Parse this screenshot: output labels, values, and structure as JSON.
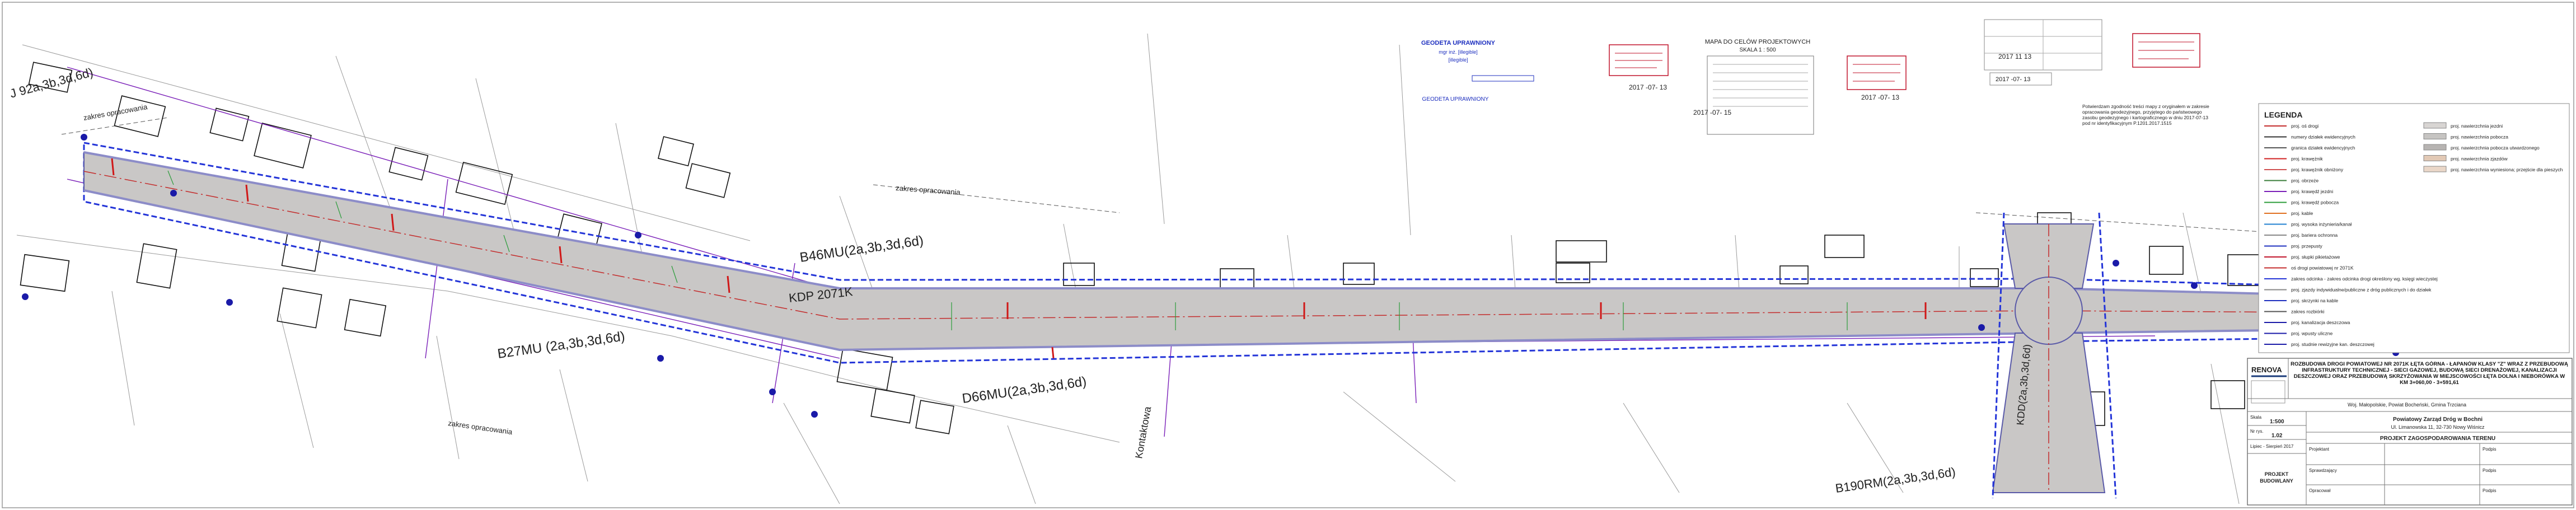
{
  "road_labels": {
    "left_top": "J 92a,3b,3d,6d)",
    "kdp": "KDP  2071K",
    "b46mu": "B46MU(2a,3b,3d,6d)",
    "b27mu": "B27MU (2a,3b,3d,6d)",
    "d66mu": "D66MU(2a,3b,3d,6d)",
    "kdd": "KDD(2a,3b,3d,6d)",
    "kontaktowa": "Kontaktowa",
    "b190rm": "B190RM(2a,3b,3d,6d)",
    "zakres1": "zakres opracowania",
    "zakres2": "zakres opracowania",
    "zakres3": "zakres opracowania"
  },
  "header": {
    "map_title_line1": "MAPA DO CELÓW PROJEKTOWYCH",
    "map_title_line2": "SKALA 1 : 500",
    "stamp_blue_title": "GEODETA UPRAWNIONY",
    "stamp_blue_line1": "mgr inż. [illegible]",
    "stamp_blue_line2": "[illegible]",
    "date1": "2017 -07- 13",
    "date2": "2017 -07- 15",
    "date3": "2017 -07- 13",
    "date4": "2017 -07- 13",
    "date5": "2017 11 13",
    "note": "Potwierdzam zgodność treści mapy z oryginałem w zakresie opracowania geodezyjnego, przyjętego do państwowego zasobu geodezyjnego i kartograficznego w dniu 2017-07-13 pod nr identyfikacyjnym P.1201.2017.1515"
  },
  "legend": {
    "title": "LEGENDA",
    "items_left": [
      "proj. oś drogi",
      "numery działek ewidencyjnych",
      "granica działek ewidencyjnych",
      "proj. krawężnik",
      "proj. krawężnik obniżony",
      "proj. obrzeże",
      "proj. krawędź jezdni",
      "proj. krawędź pobocza",
      "proj. kable",
      "proj. wysoka inżynieria/kanał",
      "proj. bariera ochronna",
      "proj. przepusty",
      "proj. słupki pikietażowe",
      "oś drogi powiatowej nr 2071K",
      "zakres odcinka - zakres odcinka drogi określony wg. księgi wieczystej",
      "proj. zjazdy indywidualne/publiczne z dróg publicznych i do działek",
      "proj. skrzynki na kable",
      "zakres rozbiórki",
      "proj. kanalizacja deszczowa",
      "proj. wpusty uliczne",
      "proj. studnie rewizyjne kan. deszczowej"
    ],
    "items_right": [
      "proj. nawierzchnia jezdni",
      "proj. nawierzchnia pobocza",
      "proj. nawierzchnia pobocza utwardzonego",
      "proj. nawierzchnia zjazdów",
      "proj. nawierzchnia wyniesiona; przejście dla pieszych"
    ]
  },
  "title_block": {
    "logo": "RENOVA",
    "title": "ROZBUDOWA DROGI POWIATOWEJ NR 2071K ŁĘTA GÓRNA - ŁAPANÓW KLASY \"Z\" WRAZ Z PRZEBUDOWĄ INFRASTRUKTURY TECHNICZNEJ - SIECI GAZOWEJ, BUDOWĄ SIECI DRENAŻOWEJ, KANALIZACJI DESZCZOWEJ ORAZ PRZEBUDOWĄ SKRZYŻOWANIA W MIEJSCOWOŚCI ŁĘTA DOLNA I NIEBORÓWKA W KM 3+060,00 - 3+591,61",
    "location": "Woj. Małopolskie, Powiat Bocheński, Gmina Trzciana",
    "scale_label": "Skala",
    "scale": "1:500",
    "sheet_label": "Nr rys.",
    "sheet": "1.02",
    "date": "Lipiec - Sierpień 2017",
    "investor_line1": "Powiatowy Zarząd Dróg w Bochni",
    "investor_line2": "Ul. Limanowska 11, 32-730 Nowy Wiśnicz",
    "drawing_name": "PROJEKT ZAGOSPODAROWANIA TERENU",
    "phase_line1": "PROJEKT",
    "phase_line2": "BUDOWLANY",
    "designer": "Projektant",
    "checker": "Sprawdzający",
    "draftsman": "Opracował",
    "signature": "Podpis"
  }
}
